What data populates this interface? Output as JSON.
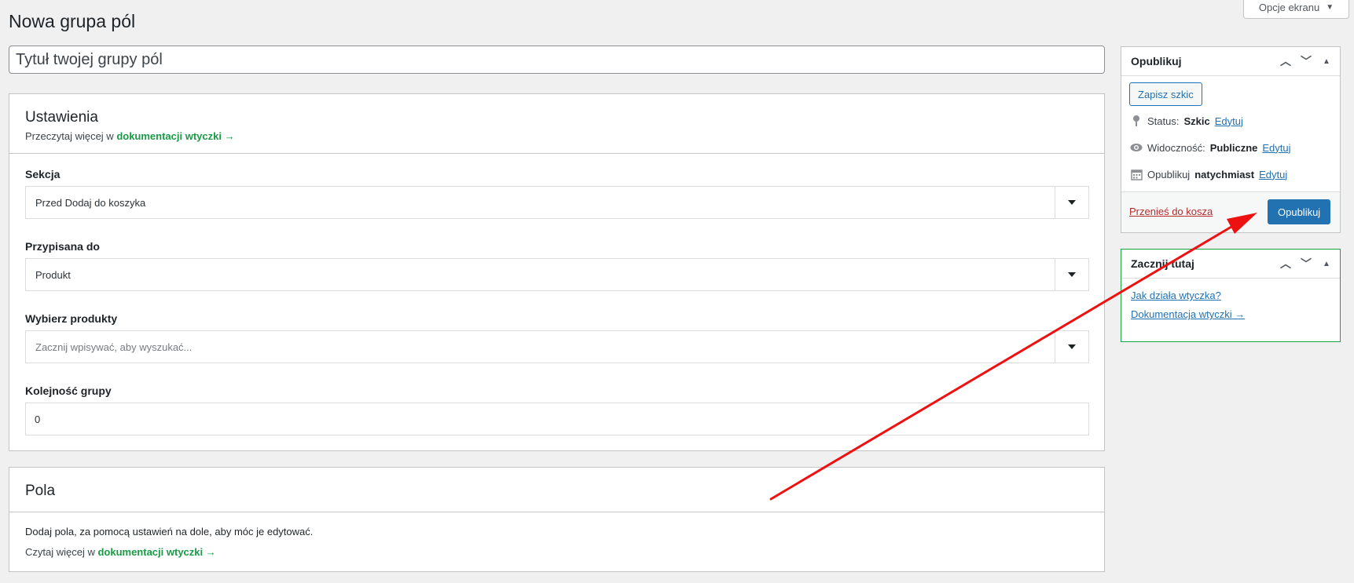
{
  "page": {
    "title": "Nowa grupa pól",
    "screen_options": "Opcje ekranu"
  },
  "title_input": {
    "placeholder": "Tytuł twojej grupy pól"
  },
  "settings": {
    "heading": "Ustawienia",
    "doc_prefix": "Przeczytaj więcej w ",
    "doc_link": "dokumentacji wtyczki →",
    "section": {
      "label": "Sekcja",
      "value": "Przed Dodaj do koszyka"
    },
    "assigned": {
      "label": "Przypisana do",
      "value": "Produkt"
    },
    "products": {
      "label": "Wybierz produkty",
      "placeholder": "Zacznij wpisywać, aby wyszukać..."
    },
    "order": {
      "label": "Kolejność grupy",
      "value": "0"
    }
  },
  "fields": {
    "heading": "Pola",
    "text": "Dodaj pola, za pomocą ustawień na dole, aby móc je edytować.",
    "doc_prefix": "Czytaj więcej w ",
    "doc_link": "dokumentacji wtyczki →"
  },
  "publish": {
    "heading": "Opublikuj",
    "save_draft": "Zapisz szkic",
    "status_label": "Status:",
    "status_value": "Szkic",
    "visibility_label": "Widoczność:",
    "visibility_value": "Publiczne",
    "publish_label": "Opublikuj",
    "publish_value": "natychmiast",
    "edit": "Edytuj",
    "trash": "Przenieś do kosza",
    "publish_button": "Opublikuj"
  },
  "start": {
    "heading": "Zacznij tutaj",
    "link1": "Jak działa wtyczka?",
    "link2": "Dokumentacja wtyczki →"
  },
  "colors": {
    "accent": "#2271b1",
    "green": "#1a9a45",
    "annotation_arrow": "#ee1111"
  },
  "icons": [
    "chevron-up-icon",
    "chevron-down-icon",
    "triangle-up-icon",
    "pin-icon",
    "eye-icon",
    "calendar-icon"
  ]
}
